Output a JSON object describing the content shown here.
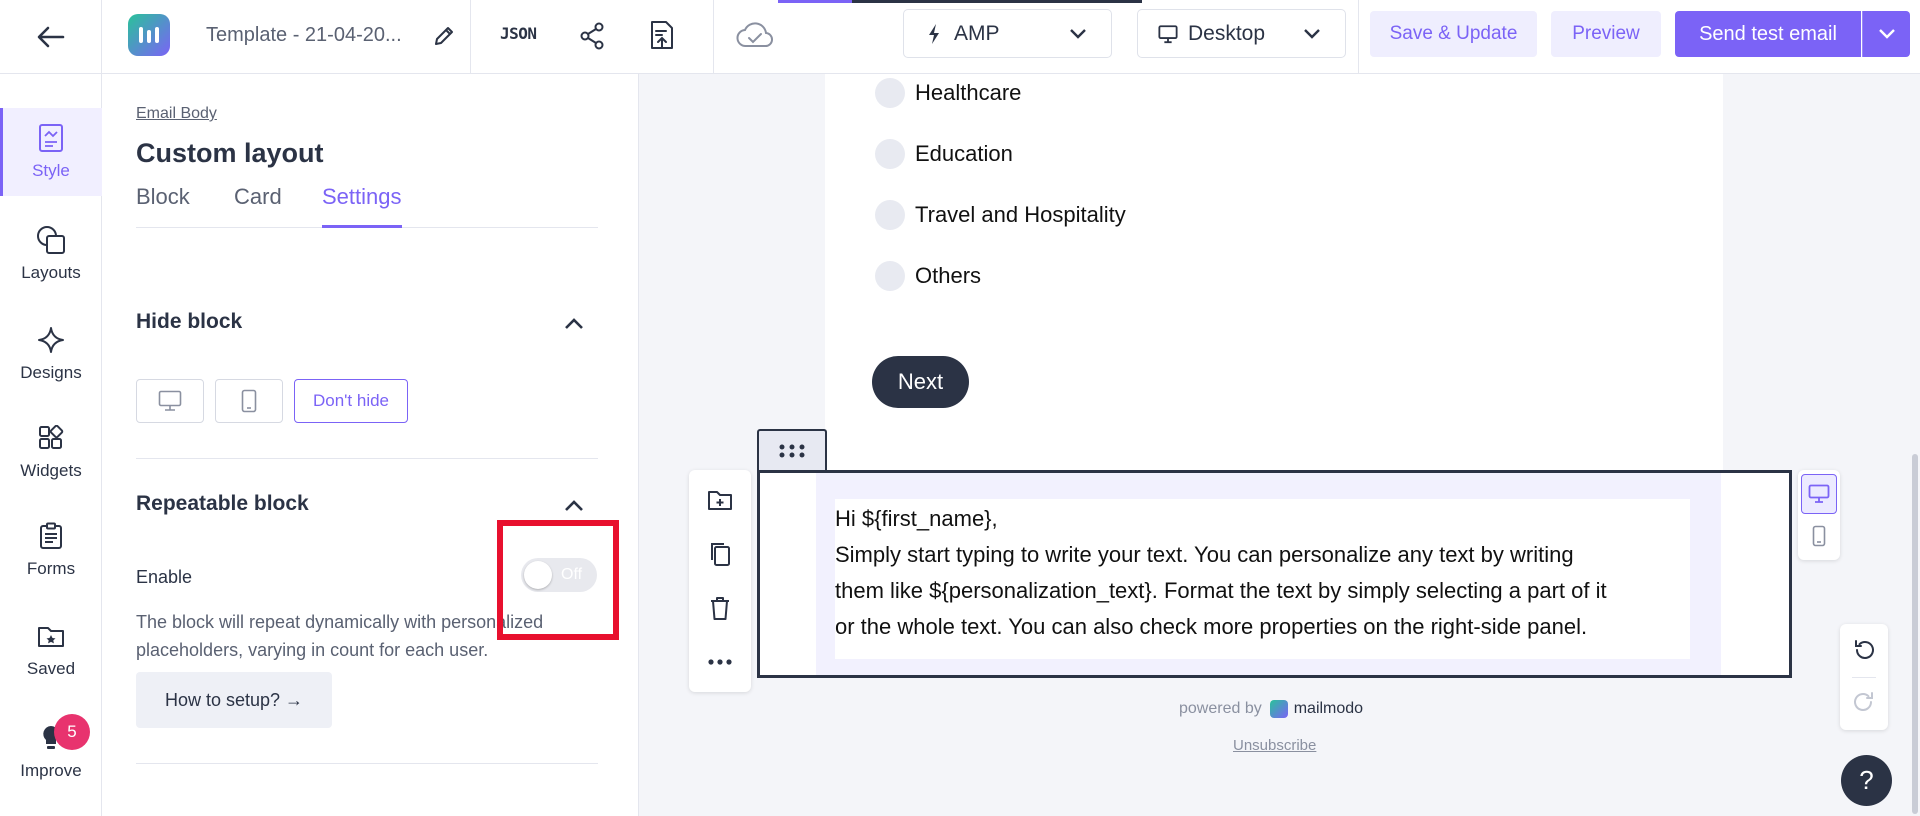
{
  "topbar": {
    "template_name": "Template - 21-04-20...",
    "json_label": "JSON",
    "amp_dropdown": "AMP",
    "device_dropdown": "Desktop",
    "save_label": "Save & Update",
    "preview_label": "Preview",
    "send_label": "Send test email"
  },
  "rail": {
    "items": [
      {
        "label": "Style",
        "icon": "style-icon"
      },
      {
        "label": "Layouts",
        "icon": "layouts-icon"
      },
      {
        "label": "Designs",
        "icon": "designs-icon"
      },
      {
        "label": "Widgets",
        "icon": "widgets-icon"
      },
      {
        "label": "Forms",
        "icon": "forms-icon"
      },
      {
        "label": "Saved",
        "icon": "saved-icon"
      },
      {
        "label": "Improve",
        "icon": "lightbulb-icon",
        "badge": "5"
      }
    ]
  },
  "panel": {
    "breadcrumb": "Email Body",
    "title": "Custom layout",
    "tabs": [
      {
        "label": "Block"
      },
      {
        "label": "Card"
      },
      {
        "label": "Settings",
        "active": true
      }
    ],
    "hide_block": {
      "title": "Hide block",
      "dont_hide_label": "Don't hide"
    },
    "repeatable_block": {
      "title": "Repeatable block",
      "enable_label": "Enable",
      "toggle_label": "Off",
      "description": "The block will repeat dynamically with personalized placeholders, varying in count for each user.",
      "howto_label": "How to setup? →"
    }
  },
  "canvas": {
    "options": [
      {
        "label": "Healthcare"
      },
      {
        "label": "Education"
      },
      {
        "label": "Travel and Hospitality"
      },
      {
        "label": "Others"
      }
    ],
    "next_label": "Next",
    "text_lines": [
      "Hi ${first_name},",
      "Simply start typing to write your text. You can personalize any text by writing",
      "them like ${personalization_text}. Format the text by simply selecting a part of it",
      "or the whole text. You can also check more properties on the right-side panel."
    ],
    "powered_by": "powered by",
    "brand": "mailmodo",
    "unsubscribe": "Unsubscribe",
    "help": "?"
  },
  "colors": {
    "accent": "#7b63f6",
    "dark": "#2b3345",
    "badge": "#e8336e",
    "highlight": "#e8102e"
  }
}
